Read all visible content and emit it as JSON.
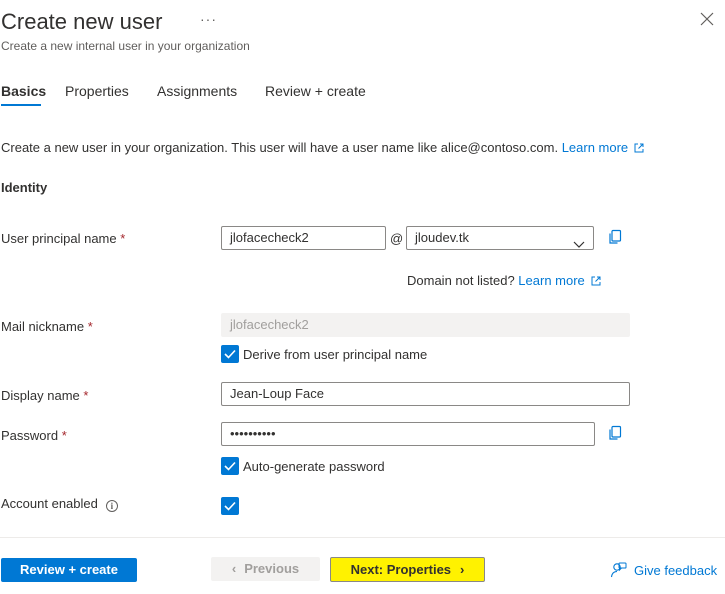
{
  "header": {
    "title": "Create new user",
    "more": "···",
    "subtitle": "Create a new internal user in your organization"
  },
  "tabs": [
    {
      "label": "Basics",
      "active": true
    },
    {
      "label": "Properties",
      "active": false
    },
    {
      "label": "Assignments",
      "active": false
    },
    {
      "label": "Review + create",
      "active": false
    }
  ],
  "intro": {
    "text": "Create a new user in your organization. This user will have a user name like alice@contoso.com.",
    "learn_more": "Learn more"
  },
  "section": {
    "identity": "Identity"
  },
  "form": {
    "upn": {
      "label": "User principal name",
      "required": "*",
      "value": "jlofacecheck2",
      "at": "@",
      "domain": "jloudev.tk"
    },
    "domain_hint": {
      "text": "Domain not listed?",
      "learn_more": "Learn more"
    },
    "mail_nickname": {
      "label": "Mail nickname",
      "required": "*",
      "value": "jlofacecheck2"
    },
    "derive": {
      "label": "Derive from user principal name",
      "checked": true
    },
    "display_name": {
      "label": "Display name",
      "required": "*",
      "value": "Jean-Loup Face"
    },
    "password": {
      "label": "Password",
      "required": "*",
      "value": "••••••••••"
    },
    "autogen": {
      "label": "Auto-generate password",
      "checked": true
    },
    "account_enabled": {
      "label": "Account enabled",
      "info": "i",
      "checked": true
    }
  },
  "footer": {
    "review_create": "Review + create",
    "previous": "Previous",
    "next": "Next: Properties",
    "feedback": "Give feedback"
  },
  "colors": {
    "accent": "#0078d4",
    "required": "#a4262c",
    "highlight": "#fff200"
  }
}
